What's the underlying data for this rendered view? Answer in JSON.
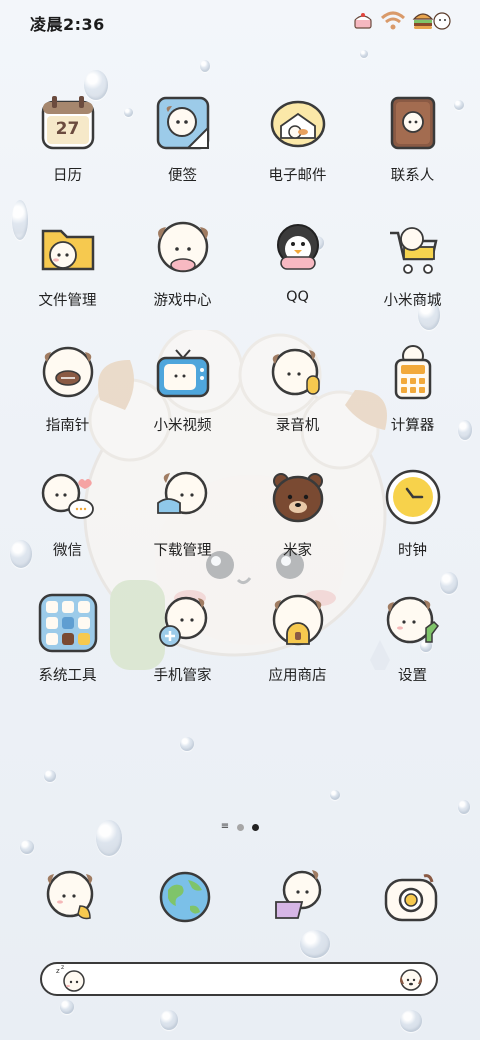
{
  "status": {
    "time": "凌晨2:36",
    "icons": [
      "cake-icon",
      "wifi-icon",
      "burger-battery-icon"
    ]
  },
  "apps": [
    {
      "label": "日历",
      "icon": "calendar-icon",
      "date": "27"
    },
    {
      "label": "便签",
      "icon": "notes-icon"
    },
    {
      "label": "电子邮件",
      "icon": "email-icon"
    },
    {
      "label": "联系人",
      "icon": "contacts-icon"
    },
    {
      "label": "文件管理",
      "icon": "file-manager-icon"
    },
    {
      "label": "游戏中心",
      "icon": "game-center-icon"
    },
    {
      "label": "QQ",
      "icon": "qq-penguin-icon"
    },
    {
      "label": "小米商城",
      "icon": "mi-store-cart-icon"
    },
    {
      "label": "指南针",
      "icon": "compass-icon"
    },
    {
      "label": "小米视频",
      "icon": "mi-video-tv-icon"
    },
    {
      "label": "录音机",
      "icon": "recorder-icon"
    },
    {
      "label": "计算器",
      "icon": "calculator-icon"
    },
    {
      "label": "微信",
      "icon": "wechat-icon"
    },
    {
      "label": "下载管理",
      "icon": "download-manager-icon"
    },
    {
      "label": "米家",
      "icon": "mijia-bear-icon"
    },
    {
      "label": "时钟",
      "icon": "clock-icon"
    },
    {
      "label": "系统工具",
      "icon": "system-tools-folder-icon"
    },
    {
      "label": "手机管家",
      "icon": "security-manager-icon"
    },
    {
      "label": "应用商店",
      "icon": "app-store-icon"
    },
    {
      "label": "设置",
      "icon": "settings-icon"
    }
  ],
  "page_indicator": {
    "pages": 2,
    "current": 2
  },
  "dock": [
    {
      "icon": "phone-icon"
    },
    {
      "icon": "browser-globe-icon"
    },
    {
      "icon": "messages-icon"
    },
    {
      "icon": "camera-icon"
    }
  ],
  "search_bar": {
    "placeholder": ""
  }
}
